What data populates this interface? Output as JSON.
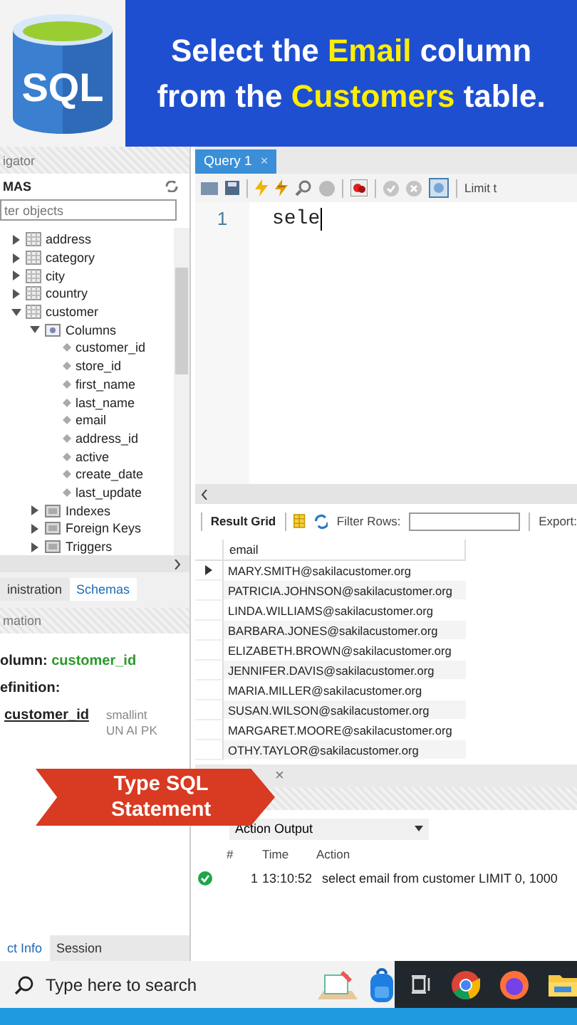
{
  "banner": {
    "logo_text": "SQL",
    "lines": [
      [
        {
          "text": "Select the ",
          "highlight": false
        },
        {
          "text": "Email",
          "highlight": true
        },
        {
          "text": " column",
          "highlight": false
        }
      ],
      [
        {
          "text": "from the ",
          "highlight": false
        },
        {
          "text": "Customers",
          "highlight": true
        },
        {
          "text": " table.",
          "highlight": false
        }
      ]
    ]
  },
  "navigator": {
    "header": "igator",
    "schemas_label": "MAS",
    "filter": {
      "placeholder": "ter objects"
    },
    "tree": [
      {
        "label": "address",
        "kind": "table",
        "expanded": false
      },
      {
        "label": "category",
        "kind": "table",
        "expanded": false
      },
      {
        "label": "city",
        "kind": "table",
        "expanded": false
      },
      {
        "label": "country",
        "kind": "table",
        "expanded": false
      },
      {
        "label": "customer",
        "kind": "table",
        "expanded": true,
        "children": [
          {
            "label": "Columns",
            "kind": "columns",
            "expanded": true,
            "children": [
              {
                "label": "customer_id",
                "kind": "column"
              },
              {
                "label": "store_id",
                "kind": "column"
              },
              {
                "label": "first_name",
                "kind": "column"
              },
              {
                "label": "last_name",
                "kind": "column"
              },
              {
                "label": "email",
                "kind": "column"
              },
              {
                "label": "address_id",
                "kind": "column"
              },
              {
                "label": "active",
                "kind": "column"
              },
              {
                "label": "create_date",
                "kind": "column"
              },
              {
                "label": "last_update",
                "kind": "column"
              }
            ]
          },
          {
            "label": "Indexes",
            "kind": "folder",
            "expanded": false
          },
          {
            "label": "Foreign Keys",
            "kind": "folder",
            "expanded": false
          },
          {
            "label": "Triggers",
            "kind": "folder",
            "expanded": false
          }
        ]
      }
    ]
  },
  "side_tabs": [
    {
      "label": "inistration",
      "selected": false
    },
    {
      "label": "Schemas",
      "selected": true
    }
  ],
  "info": {
    "header": "mation",
    "column_label": "olumn:",
    "column_value": "customer_id",
    "definition_label": "efinition:",
    "def_name": "customer_id",
    "def_type": "smallint",
    "def_flags": "UN AI PK"
  },
  "bottom_tabs": [
    {
      "label": "ct Info",
      "selected": true
    },
    {
      "label": "Session",
      "selected": false
    }
  ],
  "editor": {
    "tab": "Query 1",
    "close": "×",
    "limit": "Limit t",
    "lines": [
      {
        "number": "1",
        "code": "sele"
      }
    ]
  },
  "results": {
    "tab": "Result Grid",
    "filter_label": "Filter Rows:",
    "export_label": "Export:",
    "columns": [
      "email"
    ],
    "rows": [
      {
        "email": "MARY.SMITH@sakilacustomer.org",
        "selected": true
      },
      {
        "email": "PATRICIA.JOHNSON@sakilacustomer.org",
        "selected": false
      },
      {
        "email": "LINDA.WILLIAMS@sakilacustomer.org",
        "selected": false
      },
      {
        "email": "BARBARA.JONES@sakilacustomer.org",
        "selected": false
      },
      {
        "email": "ELIZABETH.BROWN@sakilacustomer.org",
        "selected": false
      },
      {
        "email": "JENNIFER.DAVIS@sakilacustomer.org",
        "selected": false
      },
      {
        "email": "MARIA.MILLER@sakilacustomer.org",
        "selected": false
      },
      {
        "email": "SUSAN.WILSON@sakilacustomer.org",
        "selected": false
      },
      {
        "email": "MARGARET.MOORE@sakilacustomer.org",
        "selected": false
      },
      {
        "email": "OTHY.TAYLOR@sakilacustomer.org",
        "selected": false
      }
    ]
  },
  "output": {
    "close": "×",
    "mode": "Action Output",
    "columns": [
      "#",
      "Time",
      "Action"
    ],
    "rows": [
      {
        "kind": "success",
        "number": "1",
        "time": "13:10:52",
        "action": "select email from customer LIMIT 0, 1000"
      }
    ]
  },
  "callout": {
    "lines": [
      "Type SQL",
      "Statement"
    ]
  },
  "taskbar": {
    "search_placeholder": "Type here to search"
  }
}
